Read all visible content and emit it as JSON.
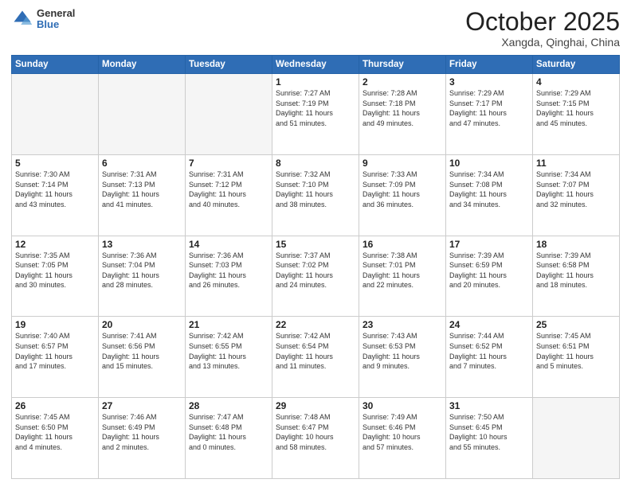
{
  "header": {
    "logo_general": "General",
    "logo_blue": "Blue",
    "title": "October 2025",
    "location": "Xangda, Qinghai, China"
  },
  "weekdays": [
    "Sunday",
    "Monday",
    "Tuesday",
    "Wednesday",
    "Thursday",
    "Friday",
    "Saturday"
  ],
  "weeks": [
    [
      {
        "day": "",
        "info": ""
      },
      {
        "day": "",
        "info": ""
      },
      {
        "day": "",
        "info": ""
      },
      {
        "day": "1",
        "info": "Sunrise: 7:27 AM\nSunset: 7:19 PM\nDaylight: 11 hours\nand 51 minutes."
      },
      {
        "day": "2",
        "info": "Sunrise: 7:28 AM\nSunset: 7:18 PM\nDaylight: 11 hours\nand 49 minutes."
      },
      {
        "day": "3",
        "info": "Sunrise: 7:29 AM\nSunset: 7:17 PM\nDaylight: 11 hours\nand 47 minutes."
      },
      {
        "day": "4",
        "info": "Sunrise: 7:29 AM\nSunset: 7:15 PM\nDaylight: 11 hours\nand 45 minutes."
      }
    ],
    [
      {
        "day": "5",
        "info": "Sunrise: 7:30 AM\nSunset: 7:14 PM\nDaylight: 11 hours\nand 43 minutes."
      },
      {
        "day": "6",
        "info": "Sunrise: 7:31 AM\nSunset: 7:13 PM\nDaylight: 11 hours\nand 41 minutes."
      },
      {
        "day": "7",
        "info": "Sunrise: 7:31 AM\nSunset: 7:12 PM\nDaylight: 11 hours\nand 40 minutes."
      },
      {
        "day": "8",
        "info": "Sunrise: 7:32 AM\nSunset: 7:10 PM\nDaylight: 11 hours\nand 38 minutes."
      },
      {
        "day": "9",
        "info": "Sunrise: 7:33 AM\nSunset: 7:09 PM\nDaylight: 11 hours\nand 36 minutes."
      },
      {
        "day": "10",
        "info": "Sunrise: 7:34 AM\nSunset: 7:08 PM\nDaylight: 11 hours\nand 34 minutes."
      },
      {
        "day": "11",
        "info": "Sunrise: 7:34 AM\nSunset: 7:07 PM\nDaylight: 11 hours\nand 32 minutes."
      }
    ],
    [
      {
        "day": "12",
        "info": "Sunrise: 7:35 AM\nSunset: 7:05 PM\nDaylight: 11 hours\nand 30 minutes."
      },
      {
        "day": "13",
        "info": "Sunrise: 7:36 AM\nSunset: 7:04 PM\nDaylight: 11 hours\nand 28 minutes."
      },
      {
        "day": "14",
        "info": "Sunrise: 7:36 AM\nSunset: 7:03 PM\nDaylight: 11 hours\nand 26 minutes."
      },
      {
        "day": "15",
        "info": "Sunrise: 7:37 AM\nSunset: 7:02 PM\nDaylight: 11 hours\nand 24 minutes."
      },
      {
        "day": "16",
        "info": "Sunrise: 7:38 AM\nSunset: 7:01 PM\nDaylight: 11 hours\nand 22 minutes."
      },
      {
        "day": "17",
        "info": "Sunrise: 7:39 AM\nSunset: 6:59 PM\nDaylight: 11 hours\nand 20 minutes."
      },
      {
        "day": "18",
        "info": "Sunrise: 7:39 AM\nSunset: 6:58 PM\nDaylight: 11 hours\nand 18 minutes."
      }
    ],
    [
      {
        "day": "19",
        "info": "Sunrise: 7:40 AM\nSunset: 6:57 PM\nDaylight: 11 hours\nand 17 minutes."
      },
      {
        "day": "20",
        "info": "Sunrise: 7:41 AM\nSunset: 6:56 PM\nDaylight: 11 hours\nand 15 minutes."
      },
      {
        "day": "21",
        "info": "Sunrise: 7:42 AM\nSunset: 6:55 PM\nDaylight: 11 hours\nand 13 minutes."
      },
      {
        "day": "22",
        "info": "Sunrise: 7:42 AM\nSunset: 6:54 PM\nDaylight: 11 hours\nand 11 minutes."
      },
      {
        "day": "23",
        "info": "Sunrise: 7:43 AM\nSunset: 6:53 PM\nDaylight: 11 hours\nand 9 minutes."
      },
      {
        "day": "24",
        "info": "Sunrise: 7:44 AM\nSunset: 6:52 PM\nDaylight: 11 hours\nand 7 minutes."
      },
      {
        "day": "25",
        "info": "Sunrise: 7:45 AM\nSunset: 6:51 PM\nDaylight: 11 hours\nand 5 minutes."
      }
    ],
    [
      {
        "day": "26",
        "info": "Sunrise: 7:45 AM\nSunset: 6:50 PM\nDaylight: 11 hours\nand 4 minutes."
      },
      {
        "day": "27",
        "info": "Sunrise: 7:46 AM\nSunset: 6:49 PM\nDaylight: 11 hours\nand 2 minutes."
      },
      {
        "day": "28",
        "info": "Sunrise: 7:47 AM\nSunset: 6:48 PM\nDaylight: 11 hours\nand 0 minutes."
      },
      {
        "day": "29",
        "info": "Sunrise: 7:48 AM\nSunset: 6:47 PM\nDaylight: 10 hours\nand 58 minutes."
      },
      {
        "day": "30",
        "info": "Sunrise: 7:49 AM\nSunset: 6:46 PM\nDaylight: 10 hours\nand 57 minutes."
      },
      {
        "day": "31",
        "info": "Sunrise: 7:50 AM\nSunset: 6:45 PM\nDaylight: 10 hours\nand 55 minutes."
      },
      {
        "day": "",
        "info": ""
      }
    ]
  ]
}
